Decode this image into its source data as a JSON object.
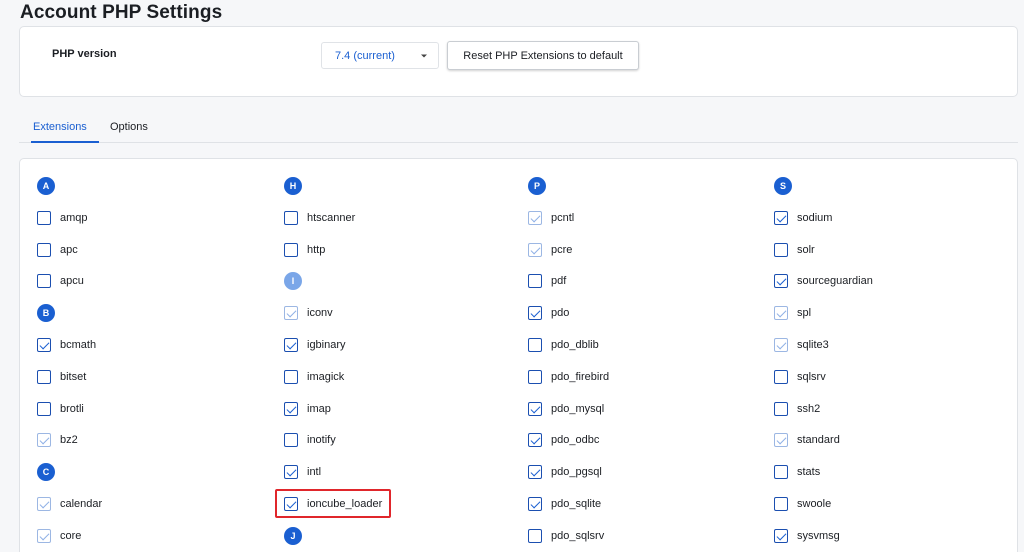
{
  "page": {
    "title": "Account PHP Settings"
  },
  "version_panel": {
    "label": "PHP version",
    "selected_version": "7.4 (current)",
    "reset_button_label": "Reset PHP Extensions to default"
  },
  "tabs": [
    {
      "label": "Extensions",
      "active": true
    },
    {
      "label": "Options",
      "active": false
    }
  ],
  "colors": {
    "accent": "#1a5fd1",
    "highlight": "#e0262b"
  },
  "extension_columns": [
    {
      "items": [
        {
          "type": "letter",
          "label": "A"
        },
        {
          "type": "ext",
          "name": "amqp",
          "checked": false,
          "disabled": false
        },
        {
          "type": "ext",
          "name": "apc",
          "checked": false,
          "disabled": false
        },
        {
          "type": "ext",
          "name": "apcu",
          "checked": false,
          "disabled": false
        },
        {
          "type": "letter",
          "label": "B"
        },
        {
          "type": "ext",
          "name": "bcmath",
          "checked": true,
          "disabled": false
        },
        {
          "type": "ext",
          "name": "bitset",
          "checked": false,
          "disabled": false
        },
        {
          "type": "ext",
          "name": "brotli",
          "checked": false,
          "disabled": false
        },
        {
          "type": "ext",
          "name": "bz2",
          "checked": true,
          "disabled": true
        },
        {
          "type": "letter",
          "label": "C"
        },
        {
          "type": "ext",
          "name": "calendar",
          "checked": true,
          "disabled": true
        },
        {
          "type": "ext",
          "name": "core",
          "checked": true,
          "disabled": true
        }
      ]
    },
    {
      "items": [
        {
          "type": "letter",
          "label": "H"
        },
        {
          "type": "ext",
          "name": "htscanner",
          "checked": false,
          "disabled": false
        },
        {
          "type": "ext",
          "name": "http",
          "checked": false,
          "disabled": false
        },
        {
          "type": "letter",
          "label": "I"
        },
        {
          "type": "ext",
          "name": "iconv",
          "checked": true,
          "disabled": true
        },
        {
          "type": "ext",
          "name": "igbinary",
          "checked": true,
          "disabled": false
        },
        {
          "type": "ext",
          "name": "imagick",
          "checked": false,
          "disabled": false
        },
        {
          "type": "ext",
          "name": "imap",
          "checked": true,
          "disabled": false
        },
        {
          "type": "ext",
          "name": "inotify",
          "checked": false,
          "disabled": false
        },
        {
          "type": "ext",
          "name": "intl",
          "checked": true,
          "disabled": false
        },
        {
          "type": "ext",
          "name": "ioncube_loader",
          "checked": true,
          "disabled": false,
          "highlighted": true
        },
        {
          "type": "letter",
          "label": "J"
        }
      ]
    },
    {
      "items": [
        {
          "type": "letter",
          "label": "P"
        },
        {
          "type": "ext",
          "name": "pcntl",
          "checked": true,
          "disabled": true
        },
        {
          "type": "ext",
          "name": "pcre",
          "checked": true,
          "disabled": true
        },
        {
          "type": "ext",
          "name": "pdf",
          "checked": false,
          "disabled": false
        },
        {
          "type": "ext",
          "name": "pdo",
          "checked": true,
          "disabled": false
        },
        {
          "type": "ext",
          "name": "pdo_dblib",
          "checked": false,
          "disabled": false
        },
        {
          "type": "ext",
          "name": "pdo_firebird",
          "checked": false,
          "disabled": false
        },
        {
          "type": "ext",
          "name": "pdo_mysql",
          "checked": true,
          "disabled": false
        },
        {
          "type": "ext",
          "name": "pdo_odbc",
          "checked": true,
          "disabled": false
        },
        {
          "type": "ext",
          "name": "pdo_pgsql",
          "checked": true,
          "disabled": false
        },
        {
          "type": "ext",
          "name": "pdo_sqlite",
          "checked": true,
          "disabled": false
        },
        {
          "type": "ext",
          "name": "pdo_sqlsrv",
          "checked": false,
          "disabled": false
        }
      ]
    },
    {
      "items": [
        {
          "type": "letter",
          "label": "S"
        },
        {
          "type": "ext",
          "name": "sodium",
          "checked": true,
          "disabled": false
        },
        {
          "type": "ext",
          "name": "solr",
          "checked": false,
          "disabled": false
        },
        {
          "type": "ext",
          "name": "sourceguardian",
          "checked": true,
          "disabled": false
        },
        {
          "type": "ext",
          "name": "spl",
          "checked": true,
          "disabled": true
        },
        {
          "type": "ext",
          "name": "sqlite3",
          "checked": true,
          "disabled": true
        },
        {
          "type": "ext",
          "name": "sqlsrv",
          "checked": false,
          "disabled": false
        },
        {
          "type": "ext",
          "name": "ssh2",
          "checked": false,
          "disabled": false
        },
        {
          "type": "ext",
          "name": "standard",
          "checked": true,
          "disabled": true
        },
        {
          "type": "ext",
          "name": "stats",
          "checked": false,
          "disabled": false
        },
        {
          "type": "ext",
          "name": "swoole",
          "checked": false,
          "disabled": false
        },
        {
          "type": "ext",
          "name": "sysvmsg",
          "checked": true,
          "disabled": false
        }
      ]
    }
  ]
}
